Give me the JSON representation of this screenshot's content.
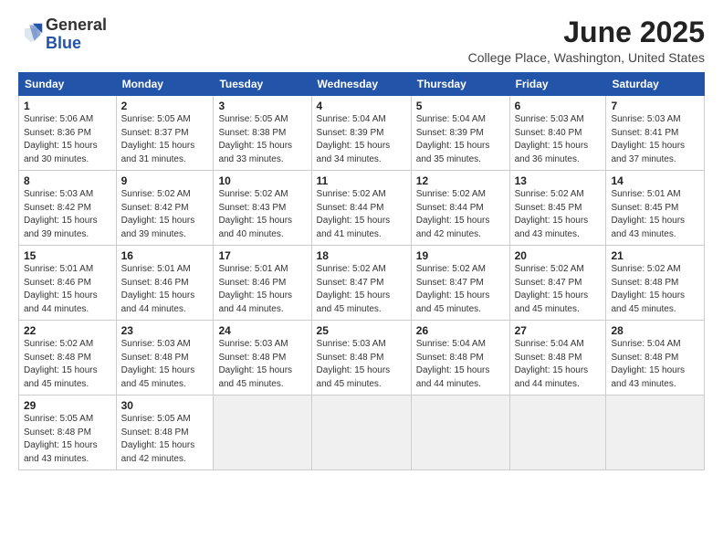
{
  "logo": {
    "general": "General",
    "blue": "Blue"
  },
  "header": {
    "title": "June 2025",
    "subtitle": "College Place, Washington, United States"
  },
  "weekdays": [
    "Sunday",
    "Monday",
    "Tuesday",
    "Wednesday",
    "Thursday",
    "Friday",
    "Saturday"
  ],
  "weeks": [
    [
      {
        "day": "1",
        "info": "Sunrise: 5:06 AM\nSunset: 8:36 PM\nDaylight: 15 hours\nand 30 minutes."
      },
      {
        "day": "2",
        "info": "Sunrise: 5:05 AM\nSunset: 8:37 PM\nDaylight: 15 hours\nand 31 minutes."
      },
      {
        "day": "3",
        "info": "Sunrise: 5:05 AM\nSunset: 8:38 PM\nDaylight: 15 hours\nand 33 minutes."
      },
      {
        "day": "4",
        "info": "Sunrise: 5:04 AM\nSunset: 8:39 PM\nDaylight: 15 hours\nand 34 minutes."
      },
      {
        "day": "5",
        "info": "Sunrise: 5:04 AM\nSunset: 8:39 PM\nDaylight: 15 hours\nand 35 minutes."
      },
      {
        "day": "6",
        "info": "Sunrise: 5:03 AM\nSunset: 8:40 PM\nDaylight: 15 hours\nand 36 minutes."
      },
      {
        "day": "7",
        "info": "Sunrise: 5:03 AM\nSunset: 8:41 PM\nDaylight: 15 hours\nand 37 minutes."
      }
    ],
    [
      {
        "day": "8",
        "info": "Sunrise: 5:03 AM\nSunset: 8:42 PM\nDaylight: 15 hours\nand 39 minutes."
      },
      {
        "day": "9",
        "info": "Sunrise: 5:02 AM\nSunset: 8:42 PM\nDaylight: 15 hours\nand 39 minutes."
      },
      {
        "day": "10",
        "info": "Sunrise: 5:02 AM\nSunset: 8:43 PM\nDaylight: 15 hours\nand 40 minutes."
      },
      {
        "day": "11",
        "info": "Sunrise: 5:02 AM\nSunset: 8:44 PM\nDaylight: 15 hours\nand 41 minutes."
      },
      {
        "day": "12",
        "info": "Sunrise: 5:02 AM\nSunset: 8:44 PM\nDaylight: 15 hours\nand 42 minutes."
      },
      {
        "day": "13",
        "info": "Sunrise: 5:02 AM\nSunset: 8:45 PM\nDaylight: 15 hours\nand 43 minutes."
      },
      {
        "day": "14",
        "info": "Sunrise: 5:01 AM\nSunset: 8:45 PM\nDaylight: 15 hours\nand 43 minutes."
      }
    ],
    [
      {
        "day": "15",
        "info": "Sunrise: 5:01 AM\nSunset: 8:46 PM\nDaylight: 15 hours\nand 44 minutes."
      },
      {
        "day": "16",
        "info": "Sunrise: 5:01 AM\nSunset: 8:46 PM\nDaylight: 15 hours\nand 44 minutes."
      },
      {
        "day": "17",
        "info": "Sunrise: 5:01 AM\nSunset: 8:46 PM\nDaylight: 15 hours\nand 44 minutes."
      },
      {
        "day": "18",
        "info": "Sunrise: 5:02 AM\nSunset: 8:47 PM\nDaylight: 15 hours\nand 45 minutes."
      },
      {
        "day": "19",
        "info": "Sunrise: 5:02 AM\nSunset: 8:47 PM\nDaylight: 15 hours\nand 45 minutes."
      },
      {
        "day": "20",
        "info": "Sunrise: 5:02 AM\nSunset: 8:47 PM\nDaylight: 15 hours\nand 45 minutes."
      },
      {
        "day": "21",
        "info": "Sunrise: 5:02 AM\nSunset: 8:48 PM\nDaylight: 15 hours\nand 45 minutes."
      }
    ],
    [
      {
        "day": "22",
        "info": "Sunrise: 5:02 AM\nSunset: 8:48 PM\nDaylight: 15 hours\nand 45 minutes."
      },
      {
        "day": "23",
        "info": "Sunrise: 5:03 AM\nSunset: 8:48 PM\nDaylight: 15 hours\nand 45 minutes."
      },
      {
        "day": "24",
        "info": "Sunrise: 5:03 AM\nSunset: 8:48 PM\nDaylight: 15 hours\nand 45 minutes."
      },
      {
        "day": "25",
        "info": "Sunrise: 5:03 AM\nSunset: 8:48 PM\nDaylight: 15 hours\nand 45 minutes."
      },
      {
        "day": "26",
        "info": "Sunrise: 5:04 AM\nSunset: 8:48 PM\nDaylight: 15 hours\nand 44 minutes."
      },
      {
        "day": "27",
        "info": "Sunrise: 5:04 AM\nSunset: 8:48 PM\nDaylight: 15 hours\nand 44 minutes."
      },
      {
        "day": "28",
        "info": "Sunrise: 5:04 AM\nSunset: 8:48 PM\nDaylight: 15 hours\nand 43 minutes."
      }
    ],
    [
      {
        "day": "29",
        "info": "Sunrise: 5:05 AM\nSunset: 8:48 PM\nDaylight: 15 hours\nand 43 minutes."
      },
      {
        "day": "30",
        "info": "Sunrise: 5:05 AM\nSunset: 8:48 PM\nDaylight: 15 hours\nand 42 minutes."
      },
      {
        "day": "",
        "info": "",
        "empty": true
      },
      {
        "day": "",
        "info": "",
        "empty": true
      },
      {
        "day": "",
        "info": "",
        "empty": true
      },
      {
        "day": "",
        "info": "",
        "empty": true
      },
      {
        "day": "",
        "info": "",
        "empty": true
      }
    ]
  ]
}
